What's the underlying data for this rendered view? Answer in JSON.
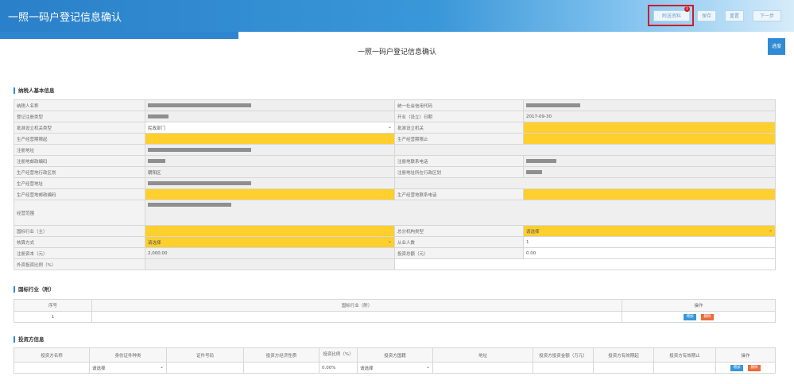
{
  "header": {
    "title": "一照一码户登记信息确认",
    "buttons": {
      "attach": "附送资料",
      "save": "保存",
      "reset": "重置",
      "next": "下一步"
    },
    "badge": "1"
  },
  "side_button": "进度",
  "page_title": "一照一码户登记信息确认",
  "basic": {
    "section_title": "纳税人基本信息",
    "labels": {
      "taxpayer_name": "纳税人名称",
      "credit_code": "统一社会信用代码",
      "reg_type": "登记注册类型",
      "open_date": "开业（设立）日期",
      "approval_org_type": "批准设立机关类型",
      "approval_org": "批准设立机关",
      "op_start": "生产经营期限起",
      "op_end": "生产经营期限止",
      "reg_addr": "注册地址",
      "reg_postcode": "注册地邮政编码",
      "reg_phone": "注册地联系电话",
      "op_district": "生产经营地行政区划",
      "reg_district": "注册地址所在行政区划",
      "op_addr": "生产经营地址",
      "op_postcode": "生产经营地邮政编码",
      "op_phone": "生产经营地联系电话",
      "scope": "经营范围",
      "industry": "国标行业（主）",
      "branch_type": "总分机构类型",
      "accounting": "核算方式",
      "employees": "从业人数",
      "reg_capital": "注册资本（元）",
      "invest_total": "投资总额（元）",
      "foreign_ratio": "外资投资比例（%）"
    },
    "values": {
      "open_date": "2017-09-30",
      "approval_org_type": "民政部门",
      "op_district": "朝阳区",
      "branch_type": "请选择",
      "accounting": "请选择",
      "employees": "1",
      "reg_capital": "2,000.00",
      "invest_total": "0.00"
    }
  },
  "industry_sub": {
    "section_title": "国标行业（附）",
    "headers": {
      "no": "序号",
      "industry": "国标行业（附）",
      "op": "操作"
    },
    "row_no": "1",
    "add": "增加",
    "del": "删除"
  },
  "investors": {
    "section_title": "投资方信息",
    "headers": [
      "投资方名称",
      "身份证件种类",
      "证件号码",
      "投资方经济性质",
      "投资比例（%）",
      "投资方国籍",
      "地址",
      "投资方投资金额（万元）",
      "投资方有效期起",
      "投资方有效期止",
      "操作"
    ],
    "row": {
      "id_type": "请选择",
      "ratio": "0.00%",
      "nationality": "请选择"
    },
    "add": "增加",
    "del": "删除"
  }
}
